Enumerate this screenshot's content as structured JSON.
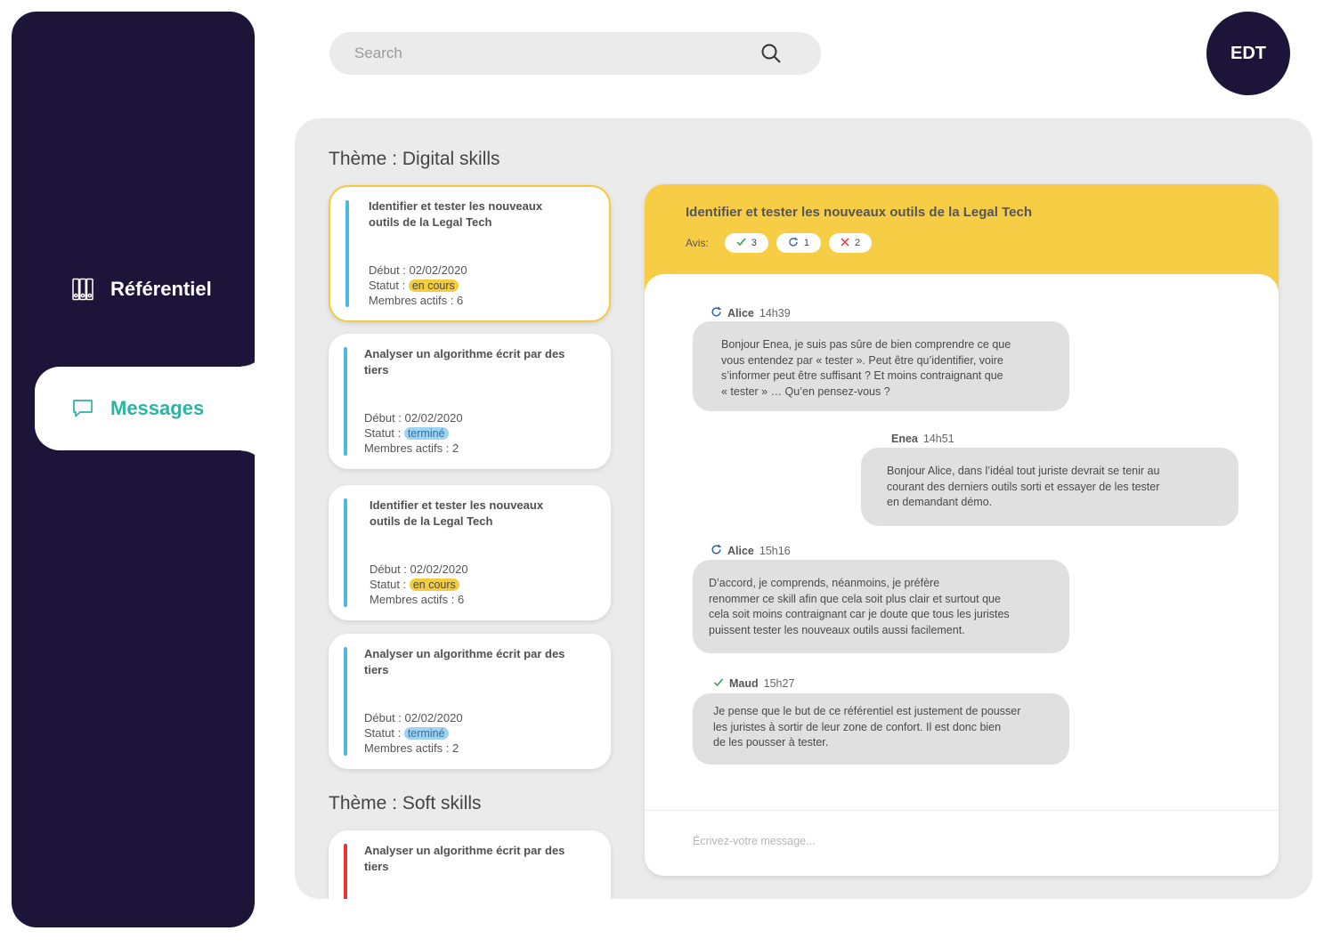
{
  "sidebar": {
    "items": [
      {
        "label": "Référentiel",
        "icon": "binders-icon"
      },
      {
        "label": "Messages",
        "icon": "chat-bubble-icon"
      }
    ]
  },
  "search": {
    "placeholder": "Search"
  },
  "user": {
    "initials": "EDT"
  },
  "themes": [
    {
      "title": "Thème : Digital skills"
    },
    {
      "title": "Thème : Soft skills"
    }
  ],
  "cards": [
    {
      "title": "Identifier et tester les nouveaux outils de la Legal Tech",
      "debut": "Début : 02/02/2020",
      "statut_label": "Statut :",
      "statut": "en cours",
      "membres": "Membres actifs : 6"
    },
    {
      "title": "Analyser un algorithme écrit par des tiers",
      "debut": "Début : 02/02/2020",
      "statut_label": "Statut :",
      "statut": "terminé",
      "membres": "Membres actifs : 2"
    },
    {
      "title": "Identifier et tester les nouveaux outils de la Legal Tech",
      "debut": "Début : 02/02/2020",
      "statut_label": "Statut :",
      "statut": "en cours",
      "membres": "Membres actifs : 6"
    },
    {
      "title": "Analyser un algorithme écrit par des tiers",
      "debut": "Début : 02/02/2020",
      "statut_label": "Statut :",
      "statut": "terminé",
      "membres": "Membres actifs : 2"
    },
    {
      "title": "Analyser un algorithme écrit par des tiers"
    }
  ],
  "chat": {
    "title": "Identifier et tester les nouveaux outils de la Legal Tech",
    "avis_label": "Avis:",
    "avis": [
      {
        "icon": "check-icon",
        "count": "3",
        "color": "#2e9e4f"
      },
      {
        "icon": "refresh-icon",
        "count": "1",
        "color": "#2a5fa8"
      },
      {
        "icon": "cross-icon",
        "count": "2",
        "color": "#e0373a"
      }
    ],
    "messages": [
      {
        "author": "Alice",
        "time": "14h39",
        "icon": "refresh-icon",
        "text": "Bonjour Enea, je suis pas sûre de bien comprendre ce que\nvous entendez par « tester ». Peut être qu’identifier, voire\ns’informer peut être suffisant ? Et moins contraignant que\n« tester » … Qu’en pensez-vous ?"
      },
      {
        "author": "Enea",
        "time": "14h51",
        "text": "Bonjour Alice, dans l’idéal tout juriste devrait se tenir au\ncourant des derniers outils sorti et essayer de les tester\nen demandant démo."
      },
      {
        "author": "Alice",
        "time": "15h16",
        "icon": "refresh-icon",
        "text": "D’accord, je comprends, néanmoins, je préfère\nrenommer ce skill afin que cela soit plus clair et surtout que\ncela soit moins contraignant car je doute que tous les juristes\npuissent tester les nouveaux outils aussi facilement."
      },
      {
        "author": "Maud",
        "time": "15h27",
        "icon": "check-icon",
        "text": "Je pense que le but de ce référentiel est justement de pousser\nles juristes à sortir de leur zone de confort. Il est donc bien\nde les pousser à tester."
      }
    ],
    "compose_placeholder": "Écrivez-votre message..."
  }
}
